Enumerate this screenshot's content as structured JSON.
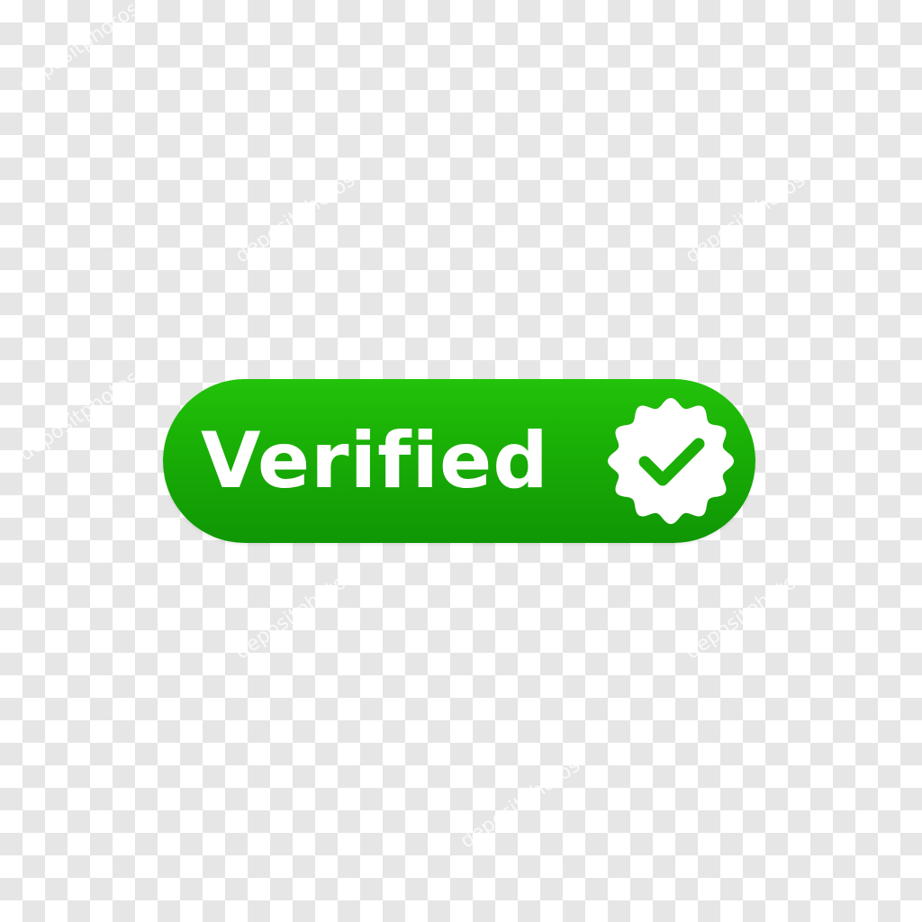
{
  "badge": {
    "label": "Verified",
    "icon": "check-seal-icon",
    "colors": {
      "fill_top": "#22c20a",
      "fill_bottom": "#0f9605",
      "text": "#ffffff",
      "seal": "#ffffff",
      "check": "#1aae06"
    }
  },
  "background": {
    "pattern": "transparency-checkerboard",
    "colors": [
      "#ffffff",
      "#e6e6e6"
    ]
  },
  "watermark": {
    "text": "depositphotos"
  }
}
